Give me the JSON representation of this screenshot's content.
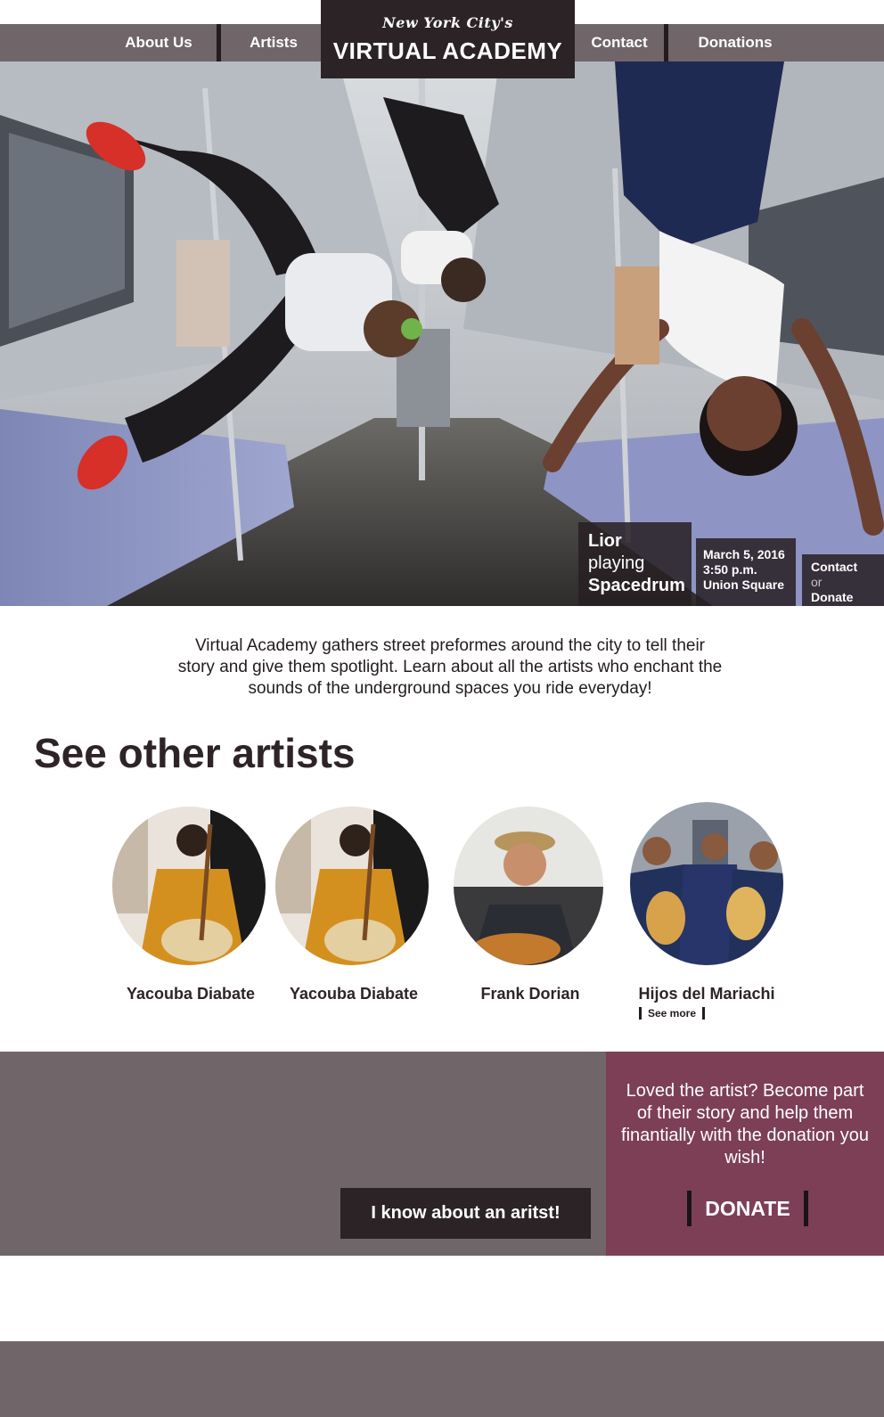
{
  "nav": {
    "items": [
      {
        "label": "About Us"
      },
      {
        "label": "Artists"
      },
      {
        "label": "Contact"
      },
      {
        "label": "Donations"
      }
    ],
    "brand_script": "New York City's",
    "brand_title": "VIRTUAL ACADEMY"
  },
  "hero": {
    "artist_name": "Lior",
    "playing_label": "playing",
    "instrument": "Spacedrum",
    "date": "March 5, 2016",
    "time": "3:50 p.m.",
    "location": "Union Square",
    "contact_label": "Contact",
    "or_label": "or",
    "donate_label": "Donate"
  },
  "intro": {
    "lines": [
      "Virtual Academy gathers street preformes around the city to tell their",
      "story and give them spotlight. Learn about all the artists who enchant the",
      "sounds of the underground spaces you ride everyday!"
    ]
  },
  "artists": {
    "title": "See other artists",
    "items": [
      {
        "name": "Yacouba Diabate"
      },
      {
        "name": "Yacouba Diabate"
      },
      {
        "name": "Frank Dorian"
      },
      {
        "name": "Hijos del Mariachi"
      }
    ],
    "see_more_label": "See more"
  },
  "cta": {
    "know_button": "I know about an aritst!",
    "donate_text": "Loved the artist? Become part of their story and help them finantially with the donation you wish!",
    "donate_button": "DONATE"
  },
  "colors": {
    "nav_gray": "#706569",
    "dark": "#2b2326",
    "plum": "#7c3f56"
  }
}
